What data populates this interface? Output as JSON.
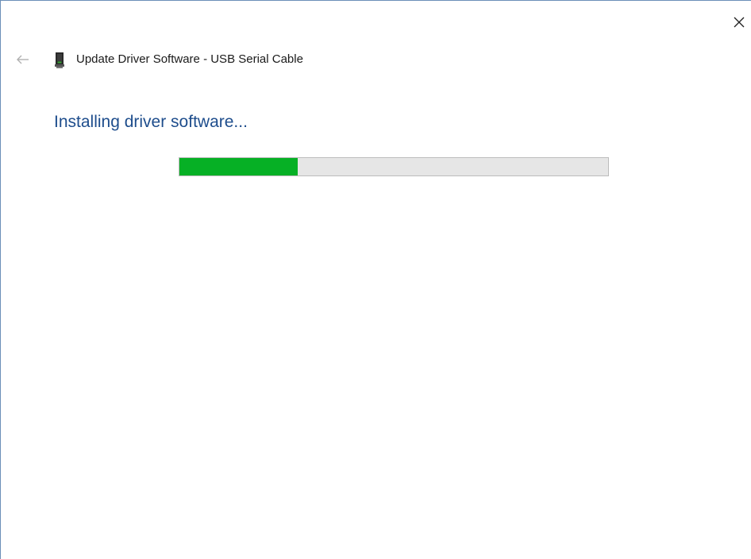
{
  "window": {
    "title": "Update Driver Software - USB Serial Cable",
    "heading": "Installing driver software..."
  },
  "progress": {
    "percent": 27.5,
    "fill_color": "#06b025",
    "track_color": "#e6e6e6"
  },
  "icons": {
    "back": "back-arrow-icon",
    "close": "close-icon",
    "device": "usb-device-icon"
  },
  "colors": {
    "heading": "#1e4d8c",
    "border": "#6b8fb8"
  }
}
